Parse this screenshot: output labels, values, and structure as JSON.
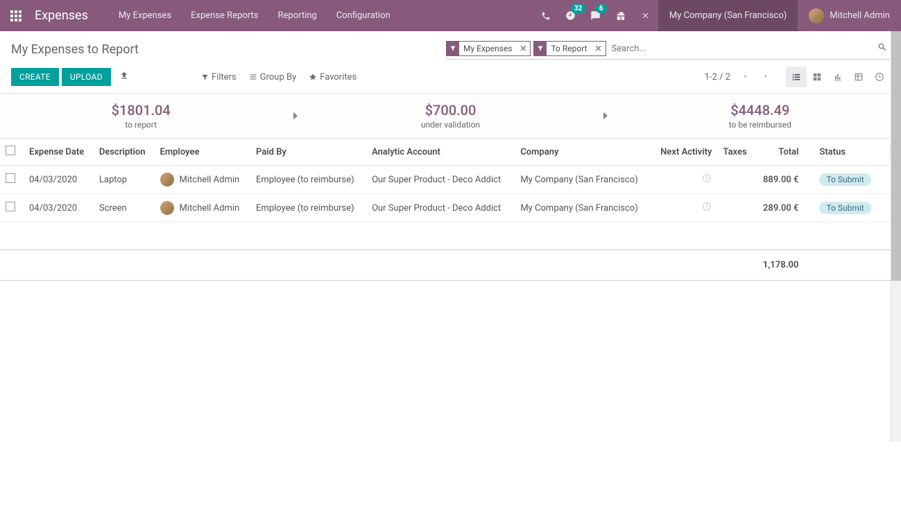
{
  "header": {
    "brand": "Expenses",
    "nav": [
      "My Expenses",
      "Expense Reports",
      "Reporting",
      "Configuration"
    ],
    "badge_activities": "32",
    "badge_messages": "6",
    "company": "My Company (San Francisco)",
    "user": "Mitchell Admin"
  },
  "page": {
    "title": "My Expenses to Report",
    "create": "CREATE",
    "upload": "UPLOAD",
    "search_placeholder": "Search...",
    "facets": [
      {
        "label": "My Expenses"
      },
      {
        "label": "To Report"
      }
    ],
    "search_opts": {
      "filters": "Filters",
      "groupby": "Group By",
      "favorites": "Favorites"
    },
    "pager": "1-2 / 2"
  },
  "stats": [
    {
      "value": "$1801.04",
      "label": "to report"
    },
    {
      "value": "$700.00",
      "label": "under validation"
    },
    {
      "value": "$4448.49",
      "label": "to be reimbursed"
    }
  ],
  "columns": {
    "date": "Expense Date",
    "desc": "Description",
    "emp": "Employee",
    "paid": "Paid By",
    "analytic": "Analytic Account",
    "company": "Company",
    "activity": "Next Activity",
    "taxes": "Taxes",
    "total": "Total",
    "status": "Status"
  },
  "rows": [
    {
      "date": "04/03/2020",
      "desc": "Laptop",
      "emp": "Mitchell Admin",
      "paid": "Employee (to reimburse)",
      "analytic": "Our Super Product - Deco Addict",
      "company": "My Company (San Francisco)",
      "total": "889.00 €",
      "status": "To Submit"
    },
    {
      "date": "04/03/2020",
      "desc": "Screen",
      "emp": "Mitchell Admin",
      "paid": "Employee (to reimburse)",
      "analytic": "Our Super Product - Deco Addict",
      "company": "My Company (San Francisco)",
      "total": "289.00 €",
      "status": "To Submit"
    }
  ],
  "footer_total": "1,178.00"
}
